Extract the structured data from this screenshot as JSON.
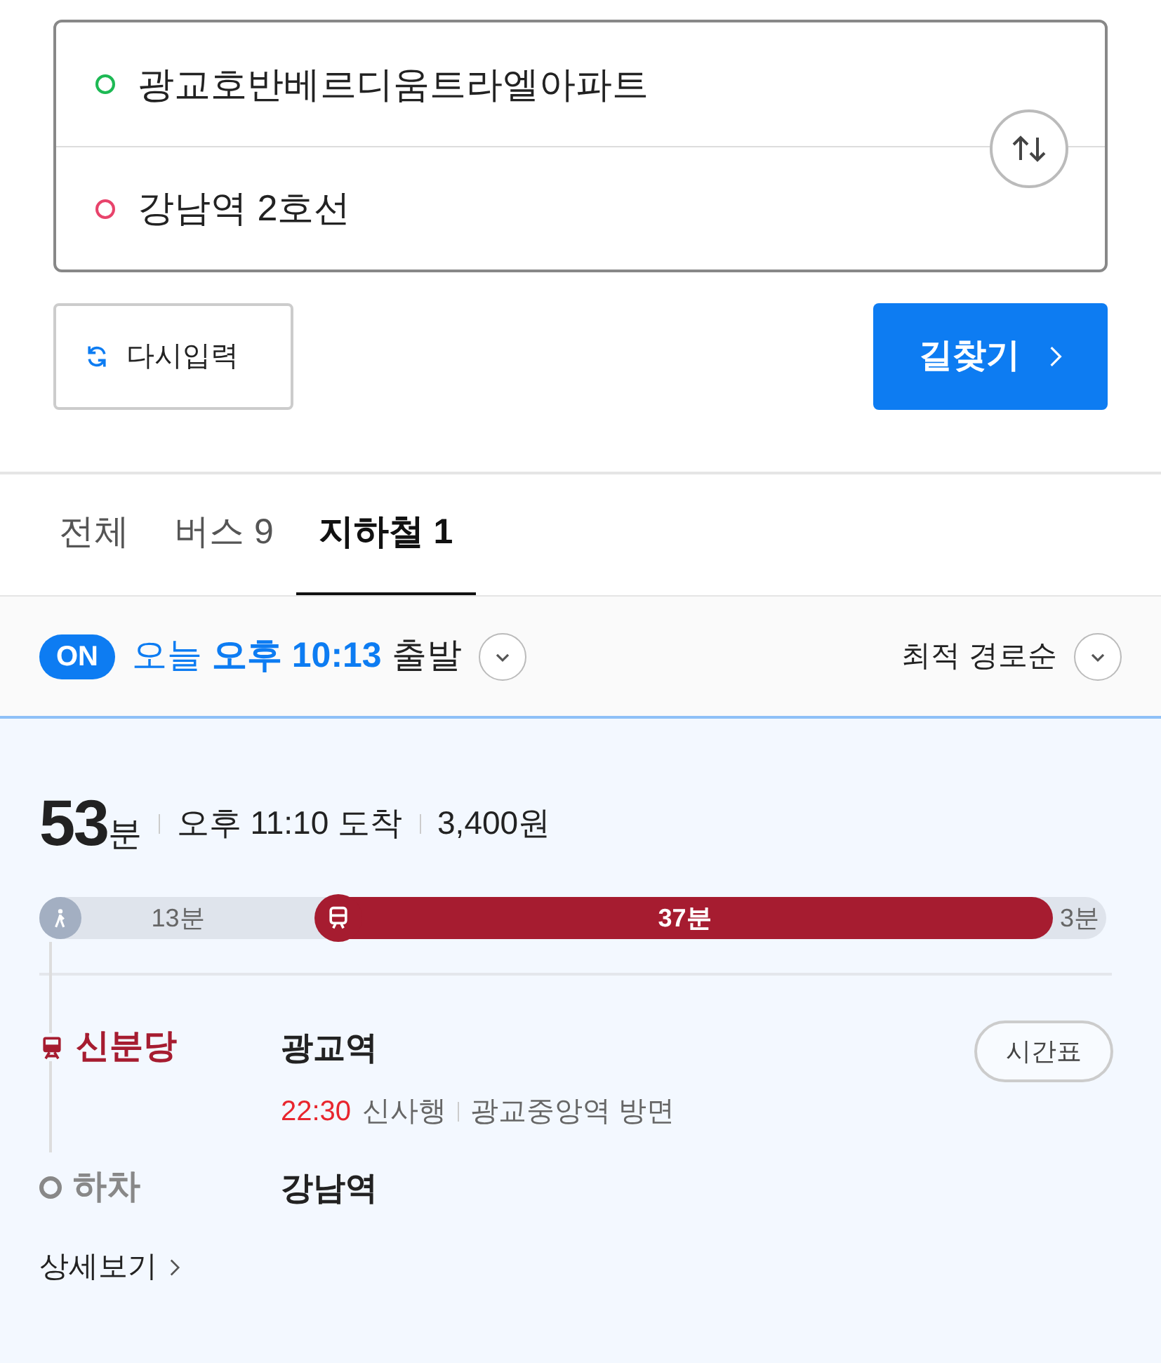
{
  "route_inputs": [
    {
      "kind": "origin",
      "value": "광교호반베르디움트라엘아파트"
    },
    {
      "kind": "destination",
      "value": "강남역 2호선"
    }
  ],
  "reset_button": "다시입력",
  "search_button": "길찾기",
  "tabs": [
    {
      "label": "전체",
      "selected": false
    },
    {
      "label": "버스 9",
      "selected": false
    },
    {
      "label": "지하철 1",
      "selected": true
    }
  ],
  "filter": {
    "realtime": {
      "label": "ON",
      "on": true
    },
    "day": "오늘",
    "time": "오후 10:13",
    "suffix": "출발",
    "sort": "최적 경로순"
  },
  "route": {
    "duration": "53",
    "duration_unit": "분",
    "arrival": "오후 11:10 도착",
    "fare": "3,400원",
    "segments": [
      {
        "kind": "walk",
        "label": "13분"
      },
      {
        "kind": "subway",
        "label": "37분"
      },
      {
        "kind": "walk",
        "label": "3분"
      }
    ],
    "steps": [
      {
        "kind": "board",
        "label": "신분당",
        "station": "광교역",
        "button": "시간표",
        "time": "22:30",
        "direction": "신사행",
        "toward": "광교중앙역 방면"
      },
      {
        "kind": "alight",
        "label": "하차",
        "station": "강남역"
      }
    ],
    "details_link": "상세보기"
  }
}
